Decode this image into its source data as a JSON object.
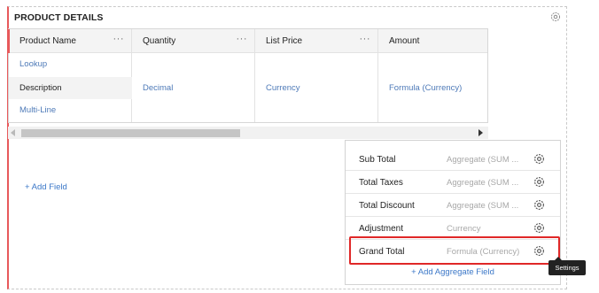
{
  "section": {
    "title": "PRODUCT DETAILS",
    "settings_icon": "gear-icon"
  },
  "grid": {
    "columns": [
      {
        "label": "Product Name",
        "menu": "···"
      },
      {
        "label": "Quantity",
        "menu": "···"
      },
      {
        "label": "List Price",
        "menu": "···"
      },
      {
        "label": "Amount",
        "menu": ""
      }
    ],
    "product_name_type": "Lookup",
    "description_label": "Description",
    "description_type": "Multi-Line",
    "quantity_type": "Decimal",
    "list_price_type": "Currency",
    "amount_type": "Formula (Currency)"
  },
  "add_field": "+ Add Field",
  "aggregates": {
    "rows": [
      {
        "label": "Sub Total",
        "type": "Aggregate (SUM ..."
      },
      {
        "label": "Total Taxes",
        "type": "Aggregate (SUM ..."
      },
      {
        "label": "Total Discount",
        "type": "Aggregate (SUM ..."
      },
      {
        "label": "Adjustment",
        "type": "Currency"
      },
      {
        "label": "Grand Total",
        "type": "Formula (Currency)"
      }
    ],
    "add_label": "+ Add Aggregate Field"
  },
  "tooltip": "Settings",
  "colors": {
    "accent_red": "#e8595b",
    "highlight_red": "#e02828",
    "link_blue": "#3c78c8"
  }
}
